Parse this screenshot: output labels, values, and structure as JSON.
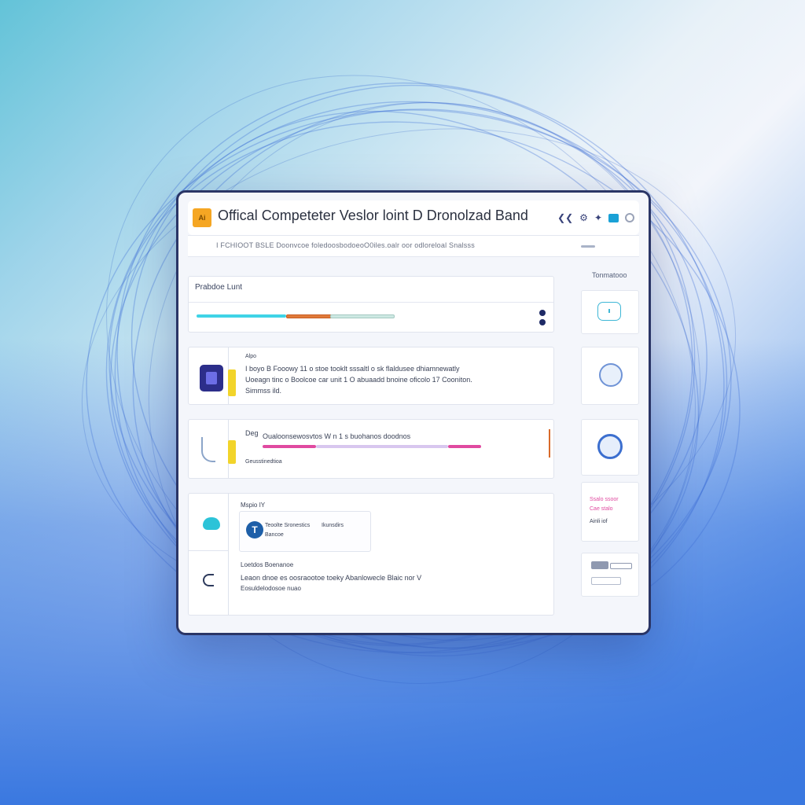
{
  "window": {
    "title": "Offical Competeter Veslor loint D Dronolzad Band",
    "logo_text": "Ai",
    "subtitle": "I FCHIOOT BSLE Doonvcoe foledoosbodoeoO0iles.oalr oor odloreloal Snalsss"
  },
  "main": {
    "progress_section": {
      "label": "Prabdoe Lunt",
      "progress_segments_colors": [
        "#3fd3e6",
        "#e07a3a",
        "#cde8e2"
      ]
    },
    "items": [
      {
        "title": "Alpo",
        "text_line1": "I boyo B Fooowy 11 o stoe tooklt sssaltl o sk flaldusee dhiamnewatly",
        "text_line2": "Uoeagn tinc o Boolcoe car unit 1 O abuaadd bnoine oficolo 17 Cooniton.",
        "text_line3": "Simmss ild."
      },
      {
        "title": "Deg",
        "text_line1": "Oualoonsewosvtos W n 1 s buohanos doodnos",
        "text_line2": "Geusstinedtioa"
      },
      {
        "title": "Mspio  IY",
        "sub_box_line1": "Teoolte Sronestics",
        "sub_box_line2": "Ikunsdirs",
        "sub_box_line3": "Bancoe"
      },
      {
        "title": "Loetdos Boenanoe",
        "text_line1": "Leaon dnoe es oosraootoe toeky Abanlowecle Blaic nor V",
        "text_line2": "Eosuldelodosoe nuao"
      }
    ]
  },
  "sidebar": {
    "header": "Tonmatooo",
    "card_text_1": "Ssalo ssoor",
    "card_text_2": "Cae stalo",
    "card_text_3": "Ainli  iof"
  },
  "colors": {
    "window_border": "#2a3566",
    "accent_yellow": "#f2d42a",
    "accent_cyan": "#3fd3e6",
    "accent_magenta": "#e04aa0"
  }
}
